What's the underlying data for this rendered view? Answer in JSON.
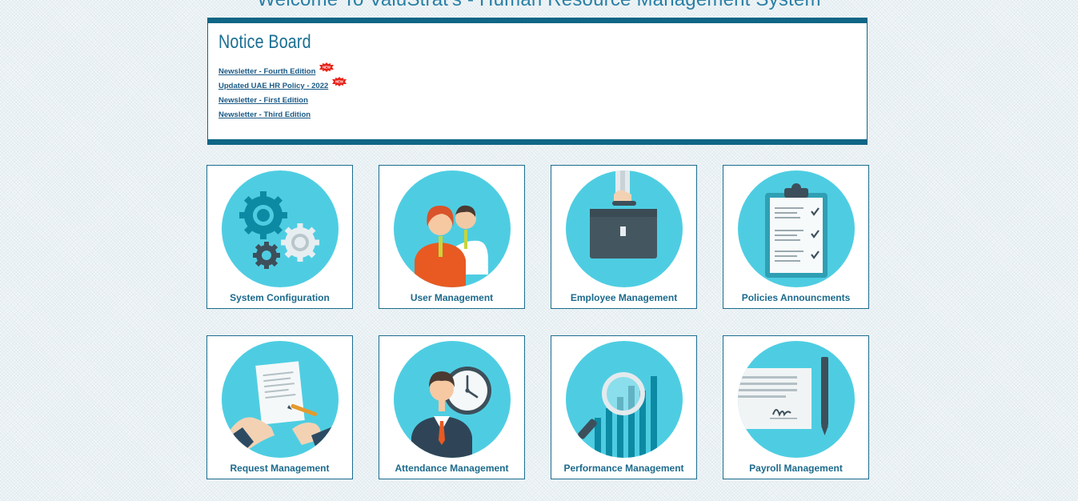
{
  "page": {
    "title": "Welcome To ValuStrat's - Human Resource Management System"
  },
  "notice_board": {
    "title": "Notice Board",
    "items": [
      {
        "label": "Newsletter - Fourth Edition",
        "badge": "NEW"
      },
      {
        "label": "Updated UAE HR Policy - 2022",
        "badge": "NEW"
      },
      {
        "label": "Newsletter - First Edition",
        "badge": ""
      },
      {
        "label": "Newsletter - Third Edition",
        "badge": ""
      }
    ]
  },
  "tiles": [
    {
      "label": "System Configuration",
      "icon": "gears-icon"
    },
    {
      "label": "User Management",
      "icon": "users-icon"
    },
    {
      "label": "Employee Management",
      "icon": "briefcase-icon"
    },
    {
      "label": "Policies Announcments",
      "icon": "clipboard-icon"
    },
    {
      "label": "Request Management",
      "icon": "signing-document-icon"
    },
    {
      "label": "Attendance Management",
      "icon": "clock-employee-icon"
    },
    {
      "label": "Performance Management",
      "icon": "magnifier-chart-icon"
    },
    {
      "label": "Payroll Management",
      "icon": "signed-contract-icon"
    }
  ],
  "colors": {
    "accent": "#0f6685",
    "tile_circle": "#4ecde2",
    "tile_label": "#1c6a8c",
    "link": "#1a5a86"
  }
}
